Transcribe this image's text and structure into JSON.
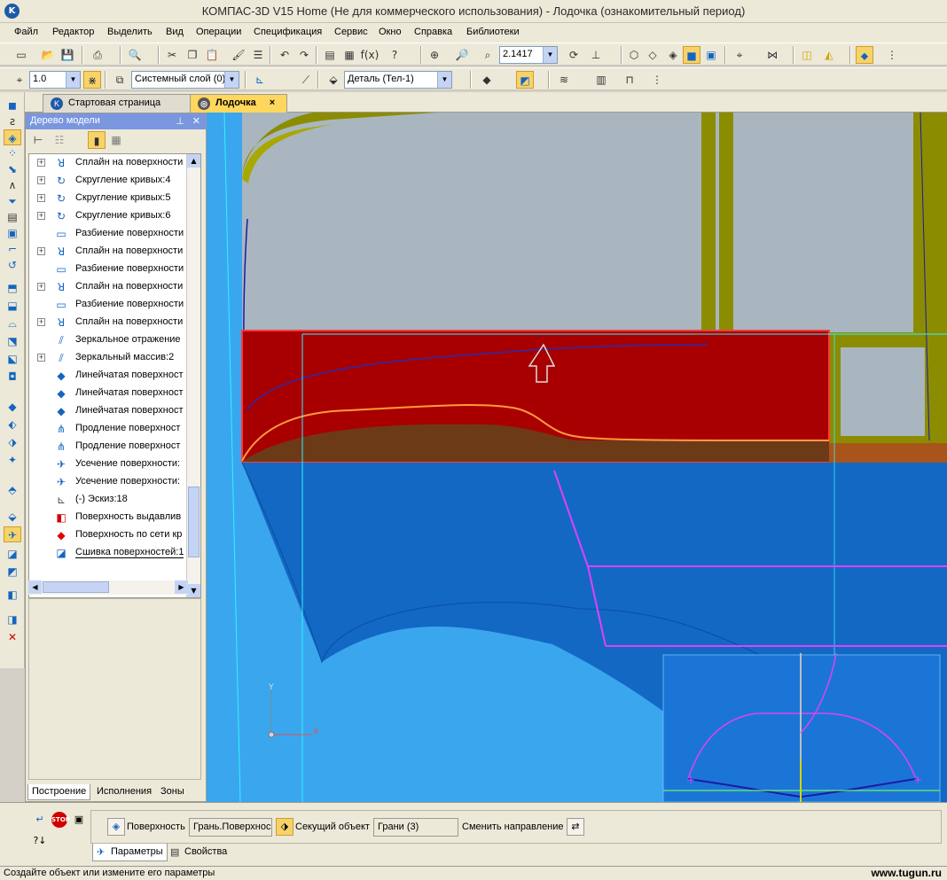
{
  "window": {
    "title": "КОМПАС-3D V15 Home (Не для коммерческого использования) - Лодочка (ознакомительный период)",
    "app_icon": "kompas-logo-icon"
  },
  "menu": [
    "Файл",
    "Редактор",
    "Выделить",
    "Вид",
    "Операции",
    "Спецификация",
    "Сервис",
    "Окно",
    "Справка",
    "Библиотеки"
  ],
  "toolbar": {
    "zoom_value": "2.1417",
    "step_value": "1.0",
    "layer_value": "Системный слой (0)",
    "detail_value": "Деталь (Тел-1)",
    "func_label": "f(x)"
  },
  "tabs": [
    {
      "label": "Стартовая страница",
      "active": false
    },
    {
      "label": "Лодочка",
      "active": true,
      "close": "×"
    }
  ],
  "tree_panel": {
    "title": "Дерево модели",
    "pin_icon": "pin-icon",
    "close_label": "✕",
    "items": [
      {
        "label": "Сплайн на поверхности",
        "expandable": true,
        "icon": "spline-icon"
      },
      {
        "label": "Скругление кривых:4",
        "expandable": true,
        "icon": "fillet-curve-icon"
      },
      {
        "label": "Скругление кривых:5",
        "expandable": true,
        "icon": "fillet-curve-icon"
      },
      {
        "label": "Скругление кривых:6",
        "expandable": true,
        "icon": "fillet-curve-icon"
      },
      {
        "label": "Разбиение поверхности",
        "expandable": false,
        "icon": "split-surface-icon"
      },
      {
        "label": "Сплайн на поверхности",
        "expandable": true,
        "icon": "spline-icon"
      },
      {
        "label": "Разбиение поверхности",
        "expandable": false,
        "icon": "split-surface-icon"
      },
      {
        "label": "Сплайн на поверхности",
        "expandable": true,
        "icon": "spline-icon"
      },
      {
        "label": "Разбиение поверхности",
        "expandable": false,
        "icon": "split-surface-icon"
      },
      {
        "label": "Сплайн на поверхности",
        "expandable": true,
        "icon": "spline-icon"
      },
      {
        "label": "Зеркальное отражение",
        "expandable": false,
        "icon": "mirror-icon"
      },
      {
        "label": "Зеркальный массив:2",
        "expandable": true,
        "icon": "mirror-array-icon"
      },
      {
        "label": "Линейчатая поверхност",
        "expandable": false,
        "icon": "ruled-surface-icon"
      },
      {
        "label": "Линейчатая поверхност",
        "expandable": false,
        "icon": "ruled-surface-icon"
      },
      {
        "label": "Линейчатая поверхност",
        "expandable": false,
        "icon": "ruled-surface-icon"
      },
      {
        "label": "Продление поверхност",
        "expandable": false,
        "icon": "extend-surface-icon"
      },
      {
        "label": "Продление поверхност",
        "expandable": false,
        "icon": "extend-surface-icon"
      },
      {
        "label": "Усечение поверхности:",
        "expandable": false,
        "icon": "trim-surface-icon"
      },
      {
        "label": "Усечение поверхности:",
        "expandable": false,
        "icon": "trim-surface-icon"
      },
      {
        "label": "(-) Эскиз:18",
        "expandable": false,
        "icon": "sketch-icon"
      },
      {
        "label": "Поверхность выдавлив",
        "expandable": false,
        "icon": "extrude-surface-icon"
      },
      {
        "label": "Поверхность по сети кр",
        "expandable": false,
        "icon": "network-surface-icon"
      },
      {
        "label": "Сшивка поверхностей:1",
        "expandable": false,
        "icon": "stitch-surface-icon",
        "selected": true
      }
    ],
    "bottom_tabs": [
      "Построение",
      "Исполнения",
      "Зоны"
    ]
  },
  "property_panel": {
    "surface_label": "Поверхность",
    "surface_value": "Грань.Поверхнос",
    "cutter_label": "Секущий объект",
    "cutter_value": "Грани (3)",
    "flip_label": "Сменить направление",
    "tabs": [
      "Параметры",
      "Свойства"
    ]
  },
  "viewport": {
    "axis_x": "X",
    "axis_y": "Y",
    "colors": {
      "background": "#3aa6ee",
      "deep_blue": "#1368c4",
      "red_face": "#a80000",
      "olive": "#8c8c00",
      "magenta": "#e040fb",
      "orange_curve": "#ff9a40"
    }
  },
  "status": {
    "text": "Создайте объект или измените его параметры",
    "watermark": "www.tugun.ru"
  }
}
